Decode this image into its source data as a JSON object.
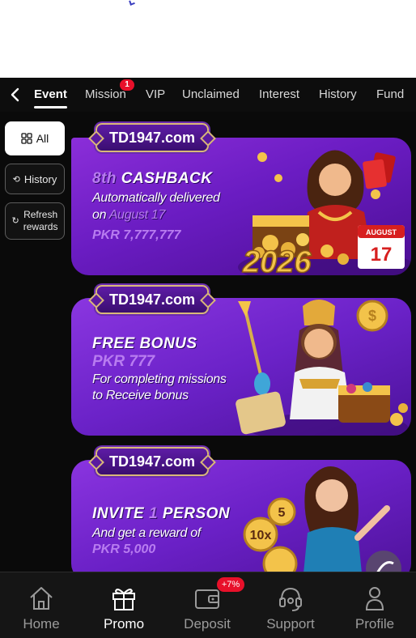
{
  "tabs": [
    {
      "label": "Event"
    },
    {
      "label": "Mission",
      "badge": "1"
    },
    {
      "label": "VIP"
    },
    {
      "label": "Unclaimed"
    },
    {
      "label": "Interest"
    },
    {
      "label": "History"
    },
    {
      "label": "Fund"
    }
  ],
  "sidebar": {
    "all_label": "All",
    "history_label": "History",
    "refresh_line1": "Refresh",
    "refresh_line2": "rewards"
  },
  "banners": [
    {
      "brand": "TD1947.com",
      "title_a": "8th",
      "title_b": "CASHBACK",
      "line1": "Automatically delivered",
      "line2_a": "on",
      "line2_b": "August 17",
      "amount": "PKR 7,777,777",
      "year": "2026",
      "calendar_month": "AUGUST",
      "calendar_day": "17"
    },
    {
      "brand": "TD1947.com",
      "title": "FREE BONUS",
      "amount": "PKR 777",
      "line1": "For completing missions",
      "line2": "to Receive bonus"
    },
    {
      "brand": "TD1947.com",
      "title_a": "INVITE",
      "title_b": "1",
      "title_c": "PERSON",
      "line1": "And get a reward of",
      "amount": "PKR 5,000"
    }
  ],
  "bottom_nav": [
    {
      "label": "Home",
      "icon": "home-icon"
    },
    {
      "label": "Promo",
      "icon": "gift-icon"
    },
    {
      "label": "Deposit",
      "icon": "wallet-icon",
      "badge": "+7%"
    },
    {
      "label": "Support",
      "icon": "headset-icon"
    },
    {
      "label": "Profile",
      "icon": "user-icon"
    }
  ],
  "colors": {
    "accent_badge": "#e8102a",
    "banner_purple": "#6a1cc2",
    "navbar_bg": "#0d0d0d"
  }
}
